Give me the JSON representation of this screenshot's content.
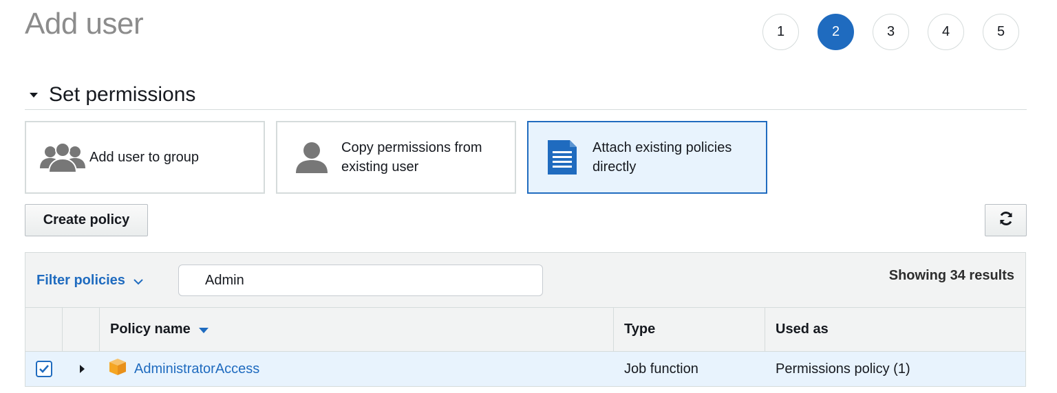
{
  "page": {
    "title": "Add user"
  },
  "wizard": {
    "steps": [
      "1",
      "2",
      "3",
      "4",
      "5"
    ],
    "active_step": "2"
  },
  "section": {
    "title": "Set permissions"
  },
  "options": {
    "add_to_group": "Add user to group",
    "copy_permissions_line1": "Copy permissions from",
    "copy_permissions_line2": "existing user",
    "attach_policies_line1": "Attach existing policies",
    "attach_policies_line2": "directly",
    "selected": "attach_policies"
  },
  "toolbar": {
    "create_policy_label": "Create policy",
    "refresh_icon": "refresh-icon"
  },
  "filter": {
    "label": "Filter policies",
    "search_value": "Admin",
    "results_text": "Showing 34 results"
  },
  "table": {
    "columns": {
      "name": "Policy name",
      "type": "Type",
      "used_as": "Used as"
    },
    "rows": [
      {
        "checked": true,
        "name": "AdministratorAccess",
        "type": "Job function",
        "used_as": "Permissions policy (1)",
        "icon": "aws-managed-policy-icon"
      }
    ]
  },
  "colors": {
    "accent": "#1f6bbf",
    "selected_bg": "#e8f3fd",
    "policy_icon": "#f5a623",
    "title_gray": "#8c8c8c"
  }
}
